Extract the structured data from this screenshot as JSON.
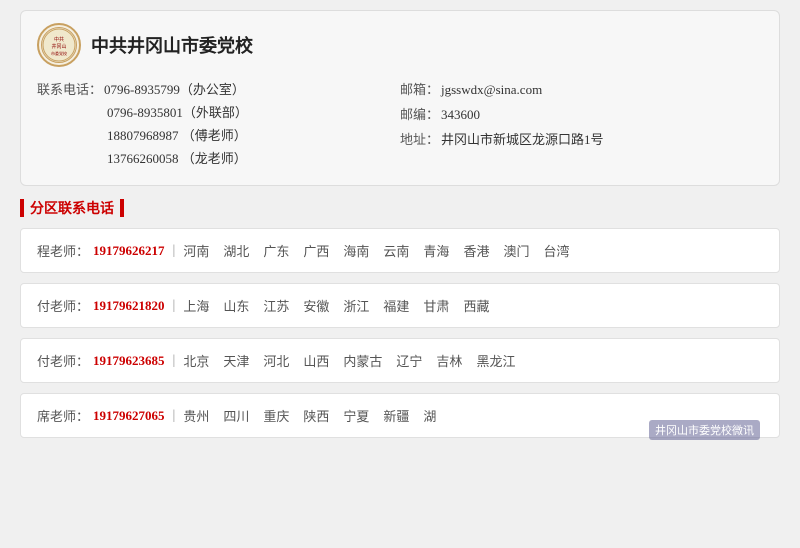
{
  "header": {
    "logo_text": "中共\n井冈山",
    "school_name": "中共井冈山市委党校",
    "contacts": {
      "label_phone": "联系电话：",
      "phone1": "0796-8935799（办公室）",
      "phone2": "0796-8935801（外联部）",
      "phone3": "18807968987  （傅老师）",
      "phone4": "13766260058  （龙老师）",
      "label_email": "邮箱：",
      "email": "jgsswdx@sina.com",
      "label_postcode": "邮编：",
      "postcode": "343600",
      "label_address": "地址：",
      "address": "井冈山市新城区龙源口路1号"
    }
  },
  "section": {
    "title": "分区联系电话"
  },
  "contact_cards": [
    {
      "person": "程老师：",
      "phone": "19179626217",
      "regions": [
        "河南",
        "湖北",
        "广东",
        "广西",
        "海南",
        "云南",
        "青海",
        "香港",
        "澳门",
        "台湾"
      ]
    },
    {
      "person": "付老师：",
      "phone": "19179621820",
      "regions": [
        "上海",
        "山东",
        "江苏",
        "安徽",
        "浙江",
        "福建",
        "甘肃",
        "西藏"
      ]
    },
    {
      "person": "付老师：",
      "phone": "19179623685",
      "regions": [
        "北京",
        "天津",
        "河北",
        "山西",
        "内蒙古",
        "辽宁",
        "吉林",
        "黑龙江"
      ]
    },
    {
      "person": "席老师：",
      "phone": "19179627065",
      "regions": [
        "贵州",
        "四川",
        "重庆",
        "陕西",
        "宁夏",
        "新疆",
        "湖"
      ]
    }
  ],
  "watermark": {
    "text": "井冈山市委党校微讯"
  }
}
